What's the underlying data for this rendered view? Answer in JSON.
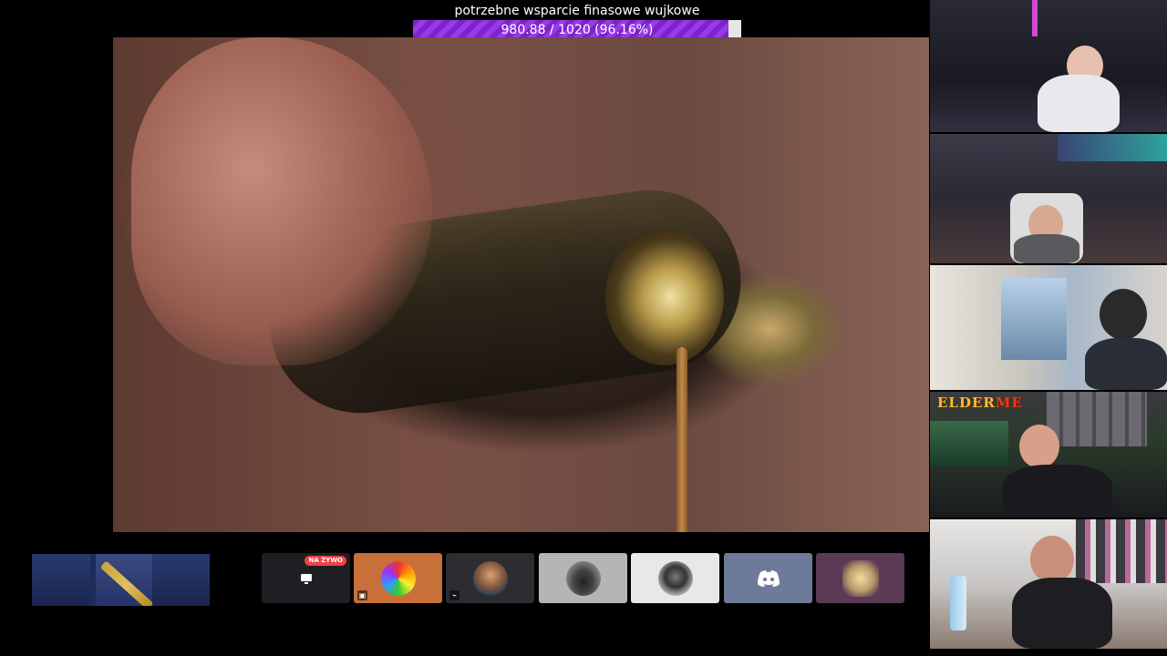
{
  "goal": {
    "title": "potrzebne wsparcie finasowe wujkowe",
    "progress_text": "980.88 / 1020 (96.16%)",
    "current": 980.88,
    "target": 1020,
    "percent": 96.16,
    "fill_color": "#8a2fd8"
  },
  "main_video": {
    "scene": "olive-oil-pour"
  },
  "skin_strip": {
    "icon": "knife-skin-icon"
  },
  "voice_tiles": [
    {
      "kind": "stream",
      "icon": "screen-share-icon",
      "badge": "NA ŻYWO",
      "bg": "#1e1f22"
    },
    {
      "kind": "user",
      "icon": "avatar-rainbow",
      "bg": "#c8703a",
      "status_icon": "screen-icon"
    },
    {
      "kind": "user",
      "icon": "avatar-man",
      "bg": "#2b2d31",
      "status_icon": "mute-icon"
    },
    {
      "kind": "user",
      "icon": "avatar-car",
      "bg": "#b5b5b5"
    },
    {
      "kind": "user",
      "icon": "avatar-bw",
      "bg": "#e8e8e8"
    },
    {
      "kind": "user",
      "icon": "discord-icon",
      "bg": "#6d7a99"
    },
    {
      "kind": "user",
      "icon": "avatar-face",
      "bg": "#5a3a55"
    }
  ],
  "webcams": [
    {
      "name": "cam-1"
    },
    {
      "name": "cam-2"
    },
    {
      "name": "cam-3"
    },
    {
      "name": "cam-4",
      "overlay_text_a": "ELDER",
      "overlay_text_b": "ME"
    },
    {
      "name": "cam-5"
    }
  ]
}
